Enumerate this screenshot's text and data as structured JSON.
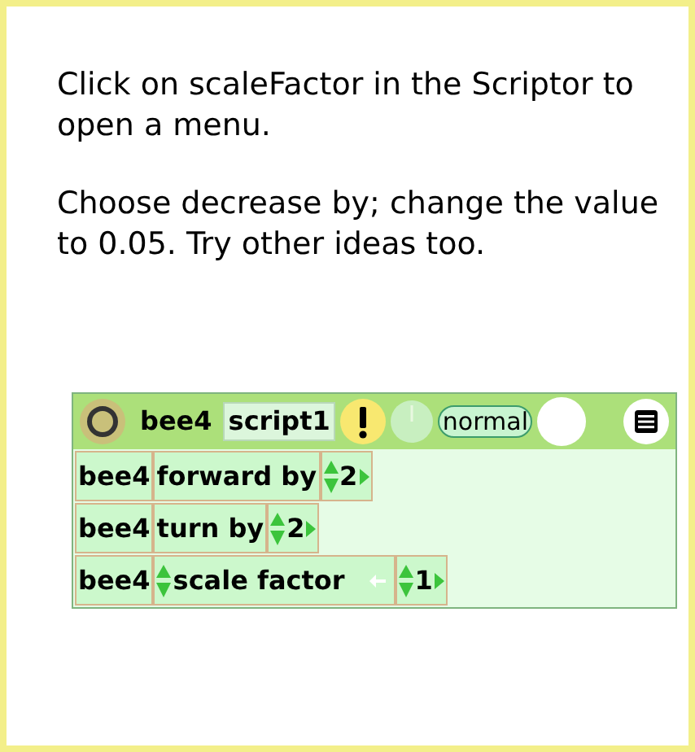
{
  "instructions": [
    "Click on scaleFactor in the Scriptor to open a menu.",
    "Choose decrease by; change the value to 0.05. Try other ideas too."
  ],
  "scriptor": {
    "player": "bee4",
    "script_name": "script1",
    "status": "normal",
    "rows": [
      {
        "kind": "command",
        "player": "bee4",
        "label": "forward by",
        "value": "2"
      },
      {
        "kind": "command",
        "player": "bee4",
        "label": "turn by",
        "value": "2"
      },
      {
        "kind": "property",
        "player": "bee4",
        "label": "scale factor",
        "value": "1"
      }
    ]
  }
}
